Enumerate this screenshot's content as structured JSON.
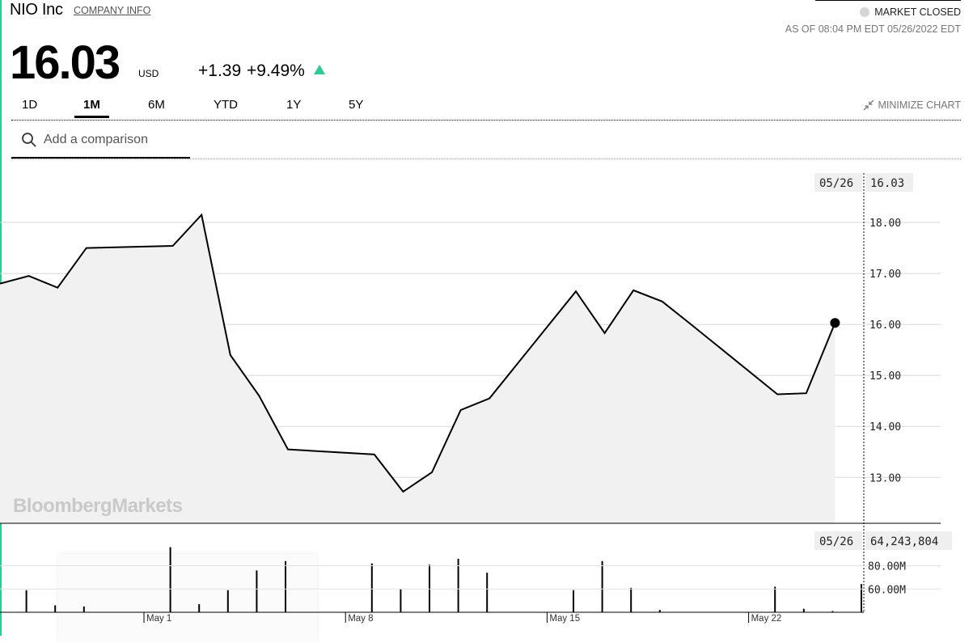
{
  "header": {
    "company_name": "NIO Inc",
    "company_info_link": "COMPANY INFO",
    "market_status": "MARKET CLOSED",
    "as_of": "AS OF 08:04 PM EDT 05/26/2022 EDT",
    "price": "16.03",
    "currency": "USD",
    "change_abs": "+1.39",
    "change_pct": "+9.49%",
    "change_direction_icon": "up-triangle-icon",
    "status_dot_color": "#d6d6d6",
    "up_color": "#2ec995"
  },
  "tabs": [
    {
      "label": "1D",
      "active": false
    },
    {
      "label": "1M",
      "active": true
    },
    {
      "label": "6M",
      "active": false
    },
    {
      "label": "YTD",
      "active": false
    },
    {
      "label": "1Y",
      "active": false
    },
    {
      "label": "5Y",
      "active": false
    }
  ],
  "minimize_label": "MINIMIZE CHART",
  "minimize_icon": "minimize-arrows-icon",
  "search": {
    "placeholder": "Add a comparison",
    "icon": "search-icon"
  },
  "watermark": "BloombergMarkets",
  "chart_data": [
    {
      "type": "area",
      "x": [
        "2022-04-26",
        "2022-04-27",
        "2022-04-28",
        "2022-04-29",
        "2022-05-02",
        "2022-05-03",
        "2022-05-04",
        "2022-05-05",
        "2022-05-06",
        "2022-05-09",
        "2022-05-10",
        "2022-05-11",
        "2022-05-12",
        "2022-05-13",
        "2022-05-16",
        "2022-05-17",
        "2022-05-18",
        "2022-05-19",
        "2022-05-20",
        "2022-05-23",
        "2022-05-24",
        "2022-05-25",
        "2022-05-26"
      ],
      "values": [
        16.8,
        16.95,
        16.72,
        17.5,
        17.54,
        18.15,
        15.4,
        14.6,
        13.55,
        13.45,
        12.72,
        13.1,
        14.32,
        14.55,
        16.65,
        15.83,
        16.67,
        16.45,
        16.0,
        14.63,
        14.65,
        16.03,
        null
      ],
      "yticks": [
        "18.00",
        "17.00",
        "16.00",
        "15.00",
        "14.00",
        "13.00"
      ],
      "ylim": [
        12.1,
        19.0
      ],
      "crosshair": {
        "date_label": "05/26",
        "value_label": "16.03"
      }
    },
    {
      "type": "bar",
      "x": [
        "2022-04-26",
        "2022-04-27",
        "2022-04-28",
        "2022-04-29",
        "2022-05-02",
        "2022-05-03",
        "2022-05-04",
        "2022-05-05",
        "2022-05-06",
        "2022-05-09",
        "2022-05-10",
        "2022-05-11",
        "2022-05-12",
        "2022-05-13",
        "2022-05-16",
        "2022-05-17",
        "2022-05-18",
        "2022-05-19",
        "2022-05-20",
        "2022-05-23",
        "2022-05-24",
        "2022-05-25",
        "2022-05-26"
      ],
      "values": [
        44000000,
        59000000,
        46000000,
        45000000,
        96000000,
        47000000,
        59000000,
        76000000,
        84000000,
        82000000,
        60000000,
        81000000,
        86000000,
        74000000,
        59000000,
        84000000,
        61000000,
        42000000,
        40000000,
        62000000,
        43000000,
        41000000,
        64243804
      ],
      "yticks": [
        "80.00M",
        "60.00M"
      ],
      "ylim": [
        40000000,
        104000000
      ],
      "xticks": [
        "May 1",
        "May 8",
        "May 15",
        "May 22"
      ],
      "crosshair": {
        "date_label": "05/26",
        "value_label": "64,243,804"
      }
    }
  ]
}
